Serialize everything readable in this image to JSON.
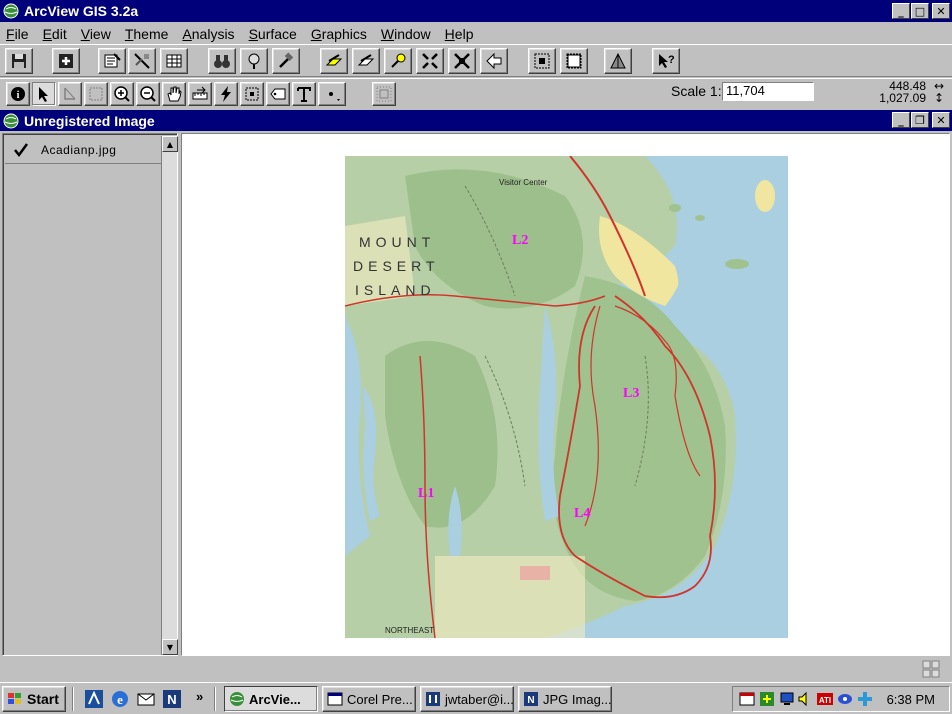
{
  "app": {
    "title": "ArcView GIS 3.2a"
  },
  "menu": [
    "File",
    "Edit",
    "View",
    "Theme",
    "Analysis",
    "Surface",
    "Graphics",
    "Window",
    "Help"
  ],
  "scale": {
    "label": "Scale 1:",
    "value": "11,704"
  },
  "coords": {
    "x": "448.48",
    "y": "1,027.09"
  },
  "document": {
    "title": "Unregistered Image"
  },
  "toc": {
    "themes": [
      {
        "name": "Acadianp.jpg",
        "checked": true
      }
    ]
  },
  "map": {
    "region_text": [
      "MOUNT",
      "DESERT",
      "ISLAND"
    ],
    "labels": [
      "L1",
      "L2",
      "L3",
      "L4"
    ],
    "small_text": [
      "Visitor Center",
      "NORTHEAST"
    ]
  },
  "taskbar": {
    "start_label": "Start",
    "tasks": [
      {
        "label": "ArcVie...",
        "active": true
      },
      {
        "label": "Corel Pre...",
        "active": false
      },
      {
        "label": "jwtaber@i...",
        "active": false
      },
      {
        "label": "JPG Imag...",
        "active": false
      }
    ],
    "quicklaunch_more": "»",
    "clock": "6:38 PM"
  },
  "colors": {
    "titlebar": "#00007b",
    "face": "#c0c0c0",
    "map_label": "#ff00ff",
    "water": "#9ec9e0",
    "land": "#a9c79a",
    "road": "#d0342c"
  }
}
